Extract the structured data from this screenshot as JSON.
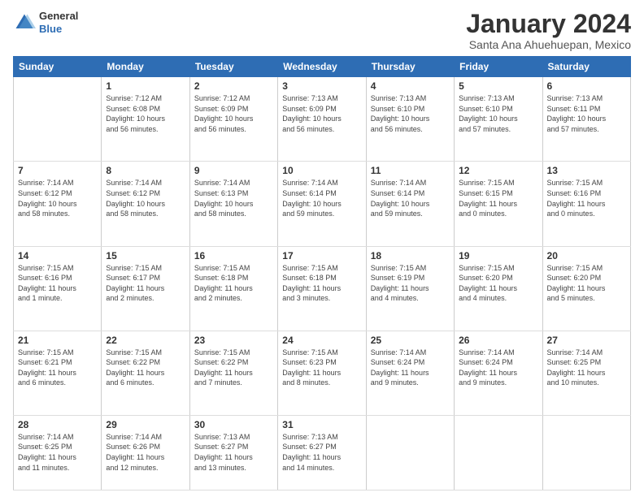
{
  "header": {
    "logo_general": "General",
    "logo_blue": "Blue",
    "month_title": "January 2024",
    "location": "Santa Ana Ahuehuepan, Mexico"
  },
  "weekdays": [
    "Sunday",
    "Monday",
    "Tuesday",
    "Wednesday",
    "Thursday",
    "Friday",
    "Saturday"
  ],
  "weeks": [
    [
      {
        "day": "",
        "info": ""
      },
      {
        "day": "1",
        "info": "Sunrise: 7:12 AM\nSunset: 6:08 PM\nDaylight: 10 hours\nand 56 minutes."
      },
      {
        "day": "2",
        "info": "Sunrise: 7:12 AM\nSunset: 6:09 PM\nDaylight: 10 hours\nand 56 minutes."
      },
      {
        "day": "3",
        "info": "Sunrise: 7:13 AM\nSunset: 6:09 PM\nDaylight: 10 hours\nand 56 minutes."
      },
      {
        "day": "4",
        "info": "Sunrise: 7:13 AM\nSunset: 6:10 PM\nDaylight: 10 hours\nand 56 minutes."
      },
      {
        "day": "5",
        "info": "Sunrise: 7:13 AM\nSunset: 6:10 PM\nDaylight: 10 hours\nand 57 minutes."
      },
      {
        "day": "6",
        "info": "Sunrise: 7:13 AM\nSunset: 6:11 PM\nDaylight: 10 hours\nand 57 minutes."
      }
    ],
    [
      {
        "day": "7",
        "info": "Sunrise: 7:14 AM\nSunset: 6:12 PM\nDaylight: 10 hours\nand 58 minutes."
      },
      {
        "day": "8",
        "info": "Sunrise: 7:14 AM\nSunset: 6:12 PM\nDaylight: 10 hours\nand 58 minutes."
      },
      {
        "day": "9",
        "info": "Sunrise: 7:14 AM\nSunset: 6:13 PM\nDaylight: 10 hours\nand 58 minutes."
      },
      {
        "day": "10",
        "info": "Sunrise: 7:14 AM\nSunset: 6:14 PM\nDaylight: 10 hours\nand 59 minutes."
      },
      {
        "day": "11",
        "info": "Sunrise: 7:14 AM\nSunset: 6:14 PM\nDaylight: 10 hours\nand 59 minutes."
      },
      {
        "day": "12",
        "info": "Sunrise: 7:15 AM\nSunset: 6:15 PM\nDaylight: 11 hours\nand 0 minutes."
      },
      {
        "day": "13",
        "info": "Sunrise: 7:15 AM\nSunset: 6:16 PM\nDaylight: 11 hours\nand 0 minutes."
      }
    ],
    [
      {
        "day": "14",
        "info": "Sunrise: 7:15 AM\nSunset: 6:16 PM\nDaylight: 11 hours\nand 1 minute."
      },
      {
        "day": "15",
        "info": "Sunrise: 7:15 AM\nSunset: 6:17 PM\nDaylight: 11 hours\nand 2 minutes."
      },
      {
        "day": "16",
        "info": "Sunrise: 7:15 AM\nSunset: 6:18 PM\nDaylight: 11 hours\nand 2 minutes."
      },
      {
        "day": "17",
        "info": "Sunrise: 7:15 AM\nSunset: 6:18 PM\nDaylight: 11 hours\nand 3 minutes."
      },
      {
        "day": "18",
        "info": "Sunrise: 7:15 AM\nSunset: 6:19 PM\nDaylight: 11 hours\nand 4 minutes."
      },
      {
        "day": "19",
        "info": "Sunrise: 7:15 AM\nSunset: 6:20 PM\nDaylight: 11 hours\nand 4 minutes."
      },
      {
        "day": "20",
        "info": "Sunrise: 7:15 AM\nSunset: 6:20 PM\nDaylight: 11 hours\nand 5 minutes."
      }
    ],
    [
      {
        "day": "21",
        "info": "Sunrise: 7:15 AM\nSunset: 6:21 PM\nDaylight: 11 hours\nand 6 minutes."
      },
      {
        "day": "22",
        "info": "Sunrise: 7:15 AM\nSunset: 6:22 PM\nDaylight: 11 hours\nand 6 minutes."
      },
      {
        "day": "23",
        "info": "Sunrise: 7:15 AM\nSunset: 6:22 PM\nDaylight: 11 hours\nand 7 minutes."
      },
      {
        "day": "24",
        "info": "Sunrise: 7:15 AM\nSunset: 6:23 PM\nDaylight: 11 hours\nand 8 minutes."
      },
      {
        "day": "25",
        "info": "Sunrise: 7:14 AM\nSunset: 6:24 PM\nDaylight: 11 hours\nand 9 minutes."
      },
      {
        "day": "26",
        "info": "Sunrise: 7:14 AM\nSunset: 6:24 PM\nDaylight: 11 hours\nand 9 minutes."
      },
      {
        "day": "27",
        "info": "Sunrise: 7:14 AM\nSunset: 6:25 PM\nDaylight: 11 hours\nand 10 minutes."
      }
    ],
    [
      {
        "day": "28",
        "info": "Sunrise: 7:14 AM\nSunset: 6:25 PM\nDaylight: 11 hours\nand 11 minutes."
      },
      {
        "day": "29",
        "info": "Sunrise: 7:14 AM\nSunset: 6:26 PM\nDaylight: 11 hours\nand 12 minutes."
      },
      {
        "day": "30",
        "info": "Sunrise: 7:13 AM\nSunset: 6:27 PM\nDaylight: 11 hours\nand 13 minutes."
      },
      {
        "day": "31",
        "info": "Sunrise: 7:13 AM\nSunset: 6:27 PM\nDaylight: 11 hours\nand 14 minutes."
      },
      {
        "day": "",
        "info": ""
      },
      {
        "day": "",
        "info": ""
      },
      {
        "day": "",
        "info": ""
      }
    ]
  ]
}
